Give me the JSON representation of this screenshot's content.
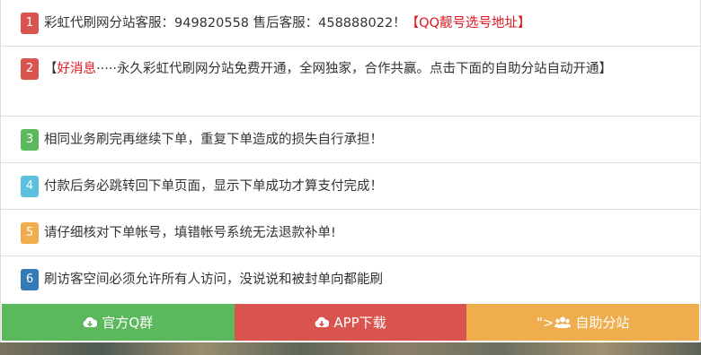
{
  "notices": [
    {
      "num": "1",
      "text": "彩虹代刷网分站客服：949820558 售后客服：458888022！",
      "link": "【QQ靓号选号地址】",
      "color": "#d9534f"
    },
    {
      "num": "2",
      "open": "【",
      "highlight": "好消息",
      "text": "·····永久彩虹代刷网分站免费开通，全网独家，合作共赢。点击下面的自助分站自动开通】",
      "color": "#d9534f"
    },
    {
      "num": "3",
      "text": "相同业务刷完再继续下单，重复下单造成的损失自行承担！",
      "color": "#5cb85c"
    },
    {
      "num": "4",
      "text": "付款后务必跳转回下单页面，显示下单成功才算支付完成！",
      "color": "#5bc0de"
    },
    {
      "num": "5",
      "text": "请仔细核对下单帐号，填错帐号系统无法退款补单!",
      "color": "#f0ad4e"
    },
    {
      "num": "6",
      "text": "刷访客空间必须允许所有人访问，没说说和被封单向都能刷",
      "color": "#337ab7"
    }
  ],
  "footer": {
    "qq_group_label": "官方Q群",
    "app_download_label": "APP下载",
    "substation_prefix": "\">",
    "substation_label": "自助分站"
  },
  "icons": {
    "qq_group": "cloud-download-icon",
    "app_download": "cloud-download-icon",
    "substation": "users-icon"
  }
}
